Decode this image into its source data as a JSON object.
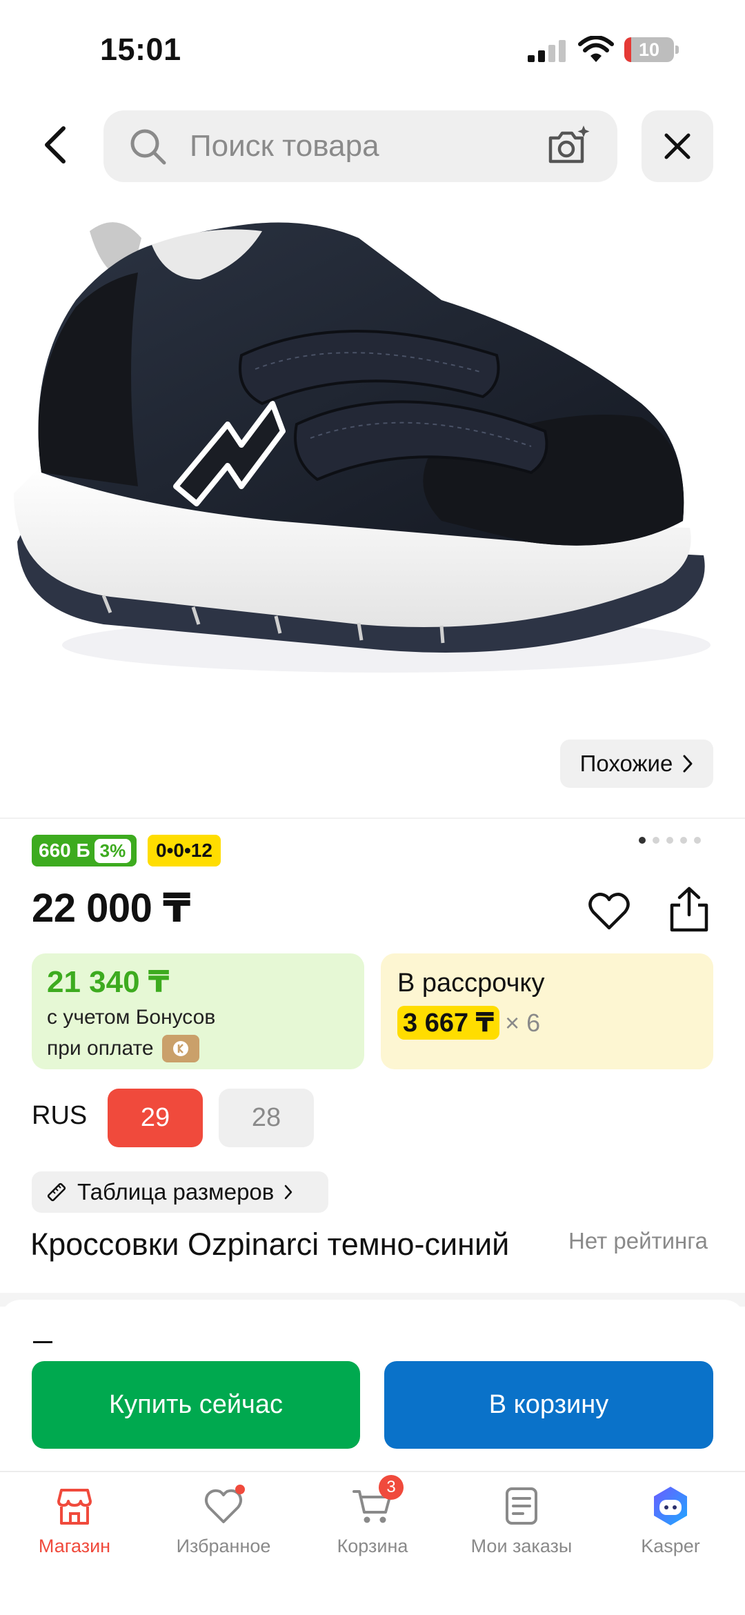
{
  "status_bar": {
    "time": "15:01",
    "battery_level": "10"
  },
  "header": {
    "search_placeholder": "Поиск товара"
  },
  "gallery": {
    "similar_label": "Похожие",
    "slide_count": 5,
    "active_slide": 1
  },
  "badges": {
    "bonus_amount": "660 Б",
    "bonus_percent": "3%",
    "installment_plan": "0•0•12"
  },
  "product": {
    "price": "22 000 ₸",
    "title": "Кроссовки Ozpinarci темно-синий",
    "rating_text": "Нет рейтинга"
  },
  "bonus_offer": {
    "price": "21 340 ₸",
    "caption_line1": "с учетом Бонусов",
    "caption_line2": "при оплате"
  },
  "installment_offer": {
    "title": "В рассрочку",
    "amount": "3 667 ₸",
    "months": "× 6"
  },
  "sizes": {
    "system": "RUS",
    "options": [
      {
        "label": "29",
        "selected": true
      },
      {
        "label": "28",
        "selected": false
      }
    ],
    "table_label": "Таблица размеров"
  },
  "actions": {
    "buy_now": "Купить сейчас",
    "add_to_cart": "В корзину"
  },
  "bottom_nav": {
    "items": [
      {
        "label": "Магазин",
        "icon": "shop-icon",
        "active": true
      },
      {
        "label": "Избранное",
        "icon": "heart-icon"
      },
      {
        "label": "Корзина",
        "icon": "cart-icon",
        "badge": "3"
      },
      {
        "label": "Мои заказы",
        "icon": "orders-icon"
      },
      {
        "label": "Kasper",
        "icon": "kasper-icon"
      }
    ]
  },
  "colors": {
    "accent_red": "#f04a3c",
    "bonus_green": "#3dab1f",
    "buy_green": "#00a94f",
    "cart_blue": "#0a72c9",
    "installment_yellow": "#ffdd00"
  }
}
